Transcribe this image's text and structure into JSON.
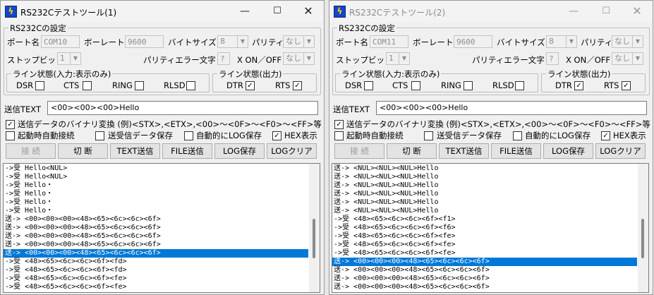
{
  "labels": {
    "settings_group": "RS232Cの設定",
    "port_name": "ポート名",
    "baud_rate": "ボーレート",
    "byte_size": "バイトサイズ",
    "parity": "パリティ",
    "stop_bit": "ストップビット",
    "parity_error_char": "パリティエラー文字",
    "xonxoff": "X ON／OFF",
    "line_in_group": "ライン状態(入力:表示のみ)",
    "line_out_group": "ライン状態(出力)",
    "dsr": "DSR",
    "cts": "CTS",
    "ring": "RING",
    "rlsd": "RLSD",
    "dtr": "DTR",
    "rts": "RTS",
    "send_text": "送信TEXT",
    "binary_convert": "送信データのバイナリ変換 (例)<STX>,<ETX>,<00>～<0F>～<F0>～<FF>等",
    "auto_connect": "起動時自動接続",
    "save_data": "送受信データ保存",
    "auto_log_save": "自動的にLOG保存",
    "hex_display": "HEX表示"
  },
  "buttons": {
    "connect": "接 続",
    "disconnect": "切 断",
    "text_send": "TEXT送信",
    "file_send": "FILE送信",
    "log_save": "LOG保存",
    "log_clear": "LOGクリア"
  },
  "window_controls": {
    "min": "—",
    "max": "☐",
    "close": "✕"
  },
  "windows": [
    {
      "title": "RS232Cテストツール(1)",
      "port": "COM10",
      "baud": "9600",
      "byte_size": "8",
      "parity": "なし",
      "stop_bit": "1",
      "parity_error_char": "?",
      "xonxoff": "なし",
      "send_text": "<00><00><00>Hello",
      "checks": {
        "dsr": false,
        "cts": false,
        "ring": false,
        "rlsd": false,
        "dtr": true,
        "rts": true,
        "binary": true,
        "auto_connect": false,
        "save_data": false,
        "auto_log": false,
        "hex": true
      },
      "scroll_fraction": 0.62,
      "selected_row": 10,
      "log": [
        "->受 Hello<NUL>",
        "->受 Hello<NUL>",
        "->受 Hello・",
        "->受 Hello・",
        "->受 Hello・",
        "->受 Hello・",
        "送-> <00><00><00><48><65><6c><6c><6f>",
        "送-> <00><00><00><48><65><6c><6c><6f>",
        "送-> <00><00><00><48><65><6c><6c><6f>",
        "送-> <00><00><00><48><65><6c><6c><6f>",
        "送-> <00><00><00><48><65><6c><6c><6f>",
        "->受 <48><65><6c><6c><6f><fd>",
        "->受 <48><65><6c><6c><6f><fd>",
        "->受 <48><65><6c><6c><6f><fe>",
        "->受 <48><65><6c><6c><6f><fe>"
      ]
    },
    {
      "title": "RS232Cテストツール(2)",
      "port": "COM11",
      "baud": "9600",
      "byte_size": "8",
      "parity": "なし",
      "stop_bit": "1",
      "parity_error_char": "?",
      "xonxoff": "なし",
      "send_text": "<00><00><00>Hello",
      "checks": {
        "dsr": false,
        "cts": false,
        "ring": false,
        "rlsd": false,
        "dtr": true,
        "rts": true,
        "binary": true,
        "auto_connect": false,
        "save_data": false,
        "auto_log": false,
        "hex": true
      },
      "scroll_fraction": 0.62,
      "selected_row": 11,
      "log": [
        "送-> <NUL><NUL><NUL>Hello",
        "送-> <NUL><NUL><NUL>Hello",
        "送-> <NUL><NUL><NUL>Hello",
        "送-> <NUL><NUL><NUL>Hello",
        "送-> <NUL><NUL><NUL>Hello",
        "送-> <NUL><NUL><NUL>Hello",
        "->受 <48><65><6c><6c><6f><f1>",
        "->受 <48><65><6c><6c><6f><f6>",
        "->受 <48><65><6c><6c><6f><fe>",
        "->受 <48><65><6c><6c><6f><fe>",
        "->受 <48><65><6c><6c><6f><fe>",
        "送-> <00><00><00><48><65><6c><6c><6f>",
        "送-> <00><00><00><48><65><6c><6c><6f>",
        "送-> <00><00><00><48><65><6c><6c><6f>",
        "送-> <00><00><00><48><65><6c><6c><6f>"
      ]
    }
  ]
}
